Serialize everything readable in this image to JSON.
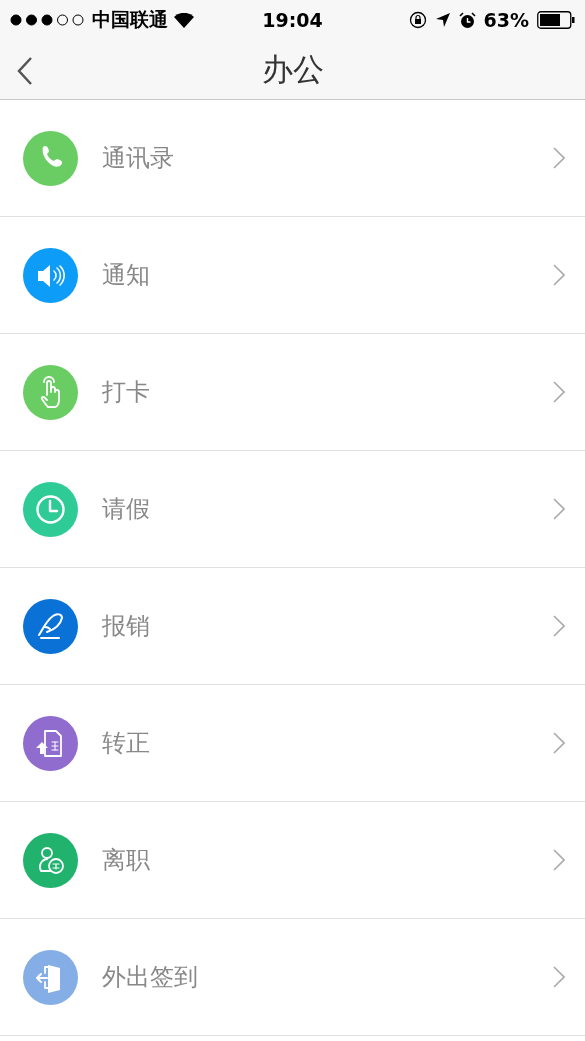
{
  "status_bar": {
    "carrier": "中国联通",
    "time": "19:04",
    "battery": "63%"
  },
  "nav_bar": {
    "title": "办公"
  },
  "items": [
    {
      "label": "通讯录",
      "color": "#6acd64"
    },
    {
      "label": "通知",
      "color": "#0d9cf8"
    },
    {
      "label": "打卡",
      "color": "#6acd64"
    },
    {
      "label": "请假",
      "color": "#2fcb96"
    },
    {
      "label": "报销",
      "color": "#0a72d6"
    },
    {
      "label": "转正",
      "color": "#8f6ccd"
    },
    {
      "label": "离职",
      "color": "#21b36e"
    },
    {
      "label": "外出签到",
      "color": "#86aee6"
    }
  ]
}
